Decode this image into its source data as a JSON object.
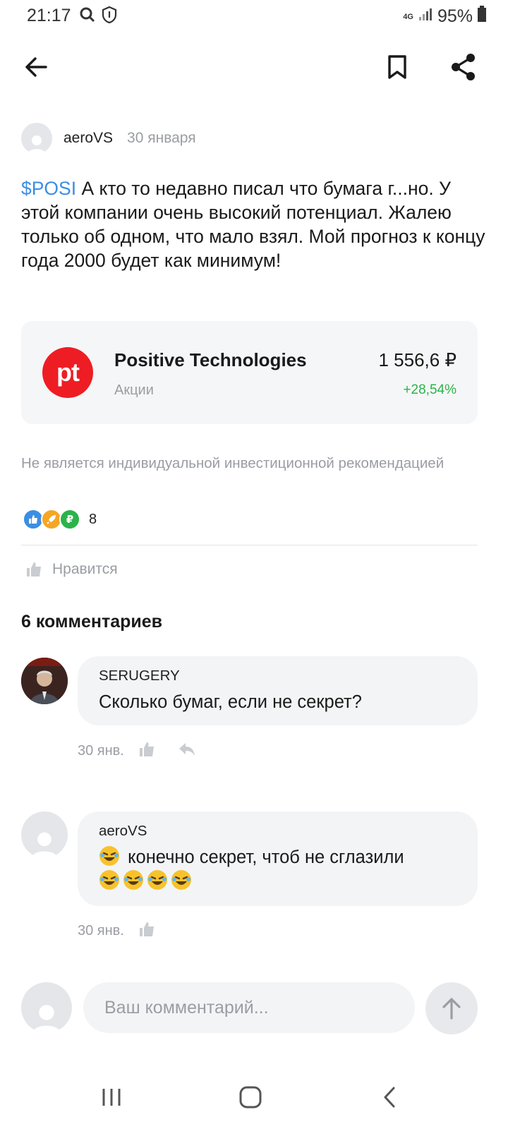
{
  "status_bar": {
    "time": "21:17",
    "network": "4G",
    "battery": "95%"
  },
  "topbar": {
    "back_icon": "arrow-left-icon",
    "bookmark_icon": "bookmark-icon",
    "share_icon": "share-icon"
  },
  "post": {
    "author": "aeroVS",
    "date": "30 января",
    "ticker": "$POSI",
    "text": " А кто то недавно писал что бумага г...но. У этой компании очень высокий потенциал. Жалею только об одном, что мало взял. Мой прогноз к концу года 2000 будет как минимум!"
  },
  "instrument": {
    "logo_text": "pt",
    "name": "Positive Technologies",
    "type": "Акции",
    "price": "1 556,6 ₽",
    "change": "+28,54%",
    "brand_color": "#ee1d23",
    "change_color": "#2bb34a"
  },
  "disclaimer": "Не является индивидуальной инвестиционной рекомендацией",
  "reactions": {
    "icons": [
      "thumbs-up-icon",
      "rocket-icon",
      "ruble-icon"
    ],
    "count": "8"
  },
  "like_label": "Нравится",
  "comments_title": "6 комментариев",
  "comments": [
    {
      "author": "SERUGERY",
      "text": "Сколько бумаг, если не секрет?",
      "date": "30 янв."
    },
    {
      "author": "aeroVS",
      "text": " конечно секрет, чтоб не сглазили",
      "date": "30 янв."
    }
  ],
  "composer": {
    "placeholder": "Ваш комментарий..."
  },
  "colors": {
    "accent": "#3b8ee3",
    "muted": "#9a9da3"
  }
}
